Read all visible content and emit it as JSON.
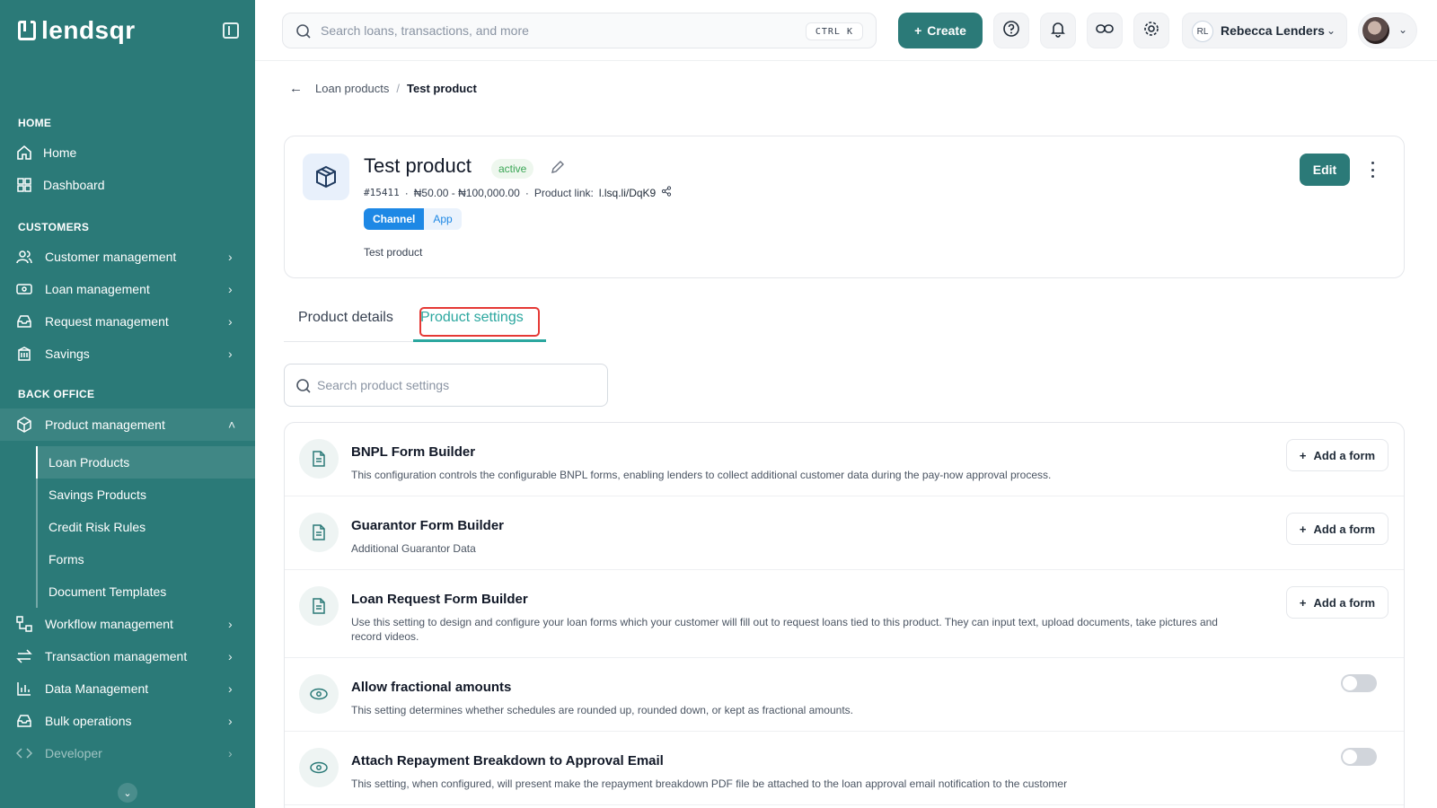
{
  "brand": {
    "name": "lendsqr"
  },
  "sidebar": {
    "sections": {
      "home": "HOME",
      "customers": "CUSTOMERS",
      "back_office": "BACK OFFICE"
    },
    "home_items": [
      "Home",
      "Dashboard"
    ],
    "customer_items": [
      "Customer management",
      "Loan management",
      "Request management",
      "Savings"
    ],
    "back_office_items": {
      "product_management": "Product management",
      "sub_items": [
        "Loan Products",
        "Savings Products",
        "Credit Risk Rules",
        "Forms",
        "Document Templates"
      ],
      "rest": [
        "Workflow management",
        "Transaction management",
        "Data Management",
        "Bulk operations",
        "Developer"
      ]
    }
  },
  "topbar": {
    "search_placeholder": "Search loans, transactions, and more",
    "shortcut": "CTRL K",
    "create_label": "Create",
    "user_initials": "RL",
    "user_name": "Rebecca Lenders"
  },
  "breadcrumb": {
    "parent": "Loan products",
    "current": "Test product"
  },
  "product": {
    "title": "Test product",
    "status": "active",
    "id": "#15411",
    "range": "₦50.00 - ₦100,000.00",
    "link_label": "Product link:",
    "link": "l.lsq.li/DqK9",
    "chip_label": "Channel",
    "chip_value": "App",
    "description": "Test product",
    "edit_label": "Edit"
  },
  "tabs": [
    "Product details",
    "Product settings"
  ],
  "settings_search_placeholder": "Search product settings",
  "settings": [
    {
      "title": "BNPL Form Builder",
      "desc": "This configuration controls the configurable BNPL forms, enabling lenders to collect additional customer data during the pay-now approval process.",
      "action": "Add a form",
      "icon": "document-icon"
    },
    {
      "title": "Guarantor Form Builder",
      "desc": "Additional Guarantor Data",
      "action": "Add a form",
      "icon": "document-icon"
    },
    {
      "title": "Loan Request Form Builder",
      "desc": "Use this setting to design and configure your loan forms which your customer will fill out to request loans tied to this product. They can input text, upload documents, take pictures and record videos.",
      "action": "Add a form",
      "icon": "document-icon"
    },
    {
      "title": "Allow fractional amounts",
      "desc": "This setting determines whether schedules are rounded up, rounded down, or kept as fractional amounts.",
      "toggle": false,
      "icon": "eye-icon"
    },
    {
      "title": "Attach Repayment Breakdown to Approval Email",
      "desc": "This setting, when configured, will present make the repayment breakdown PDF file be attached to the loan approval email notification to the customer",
      "toggle": false,
      "icon": "eye-icon"
    }
  ],
  "colors": {
    "sidebar": "#2b7a78",
    "accent": "#2ba79f",
    "highlight_outline": "#e53935",
    "chip": "#1e88e5"
  }
}
